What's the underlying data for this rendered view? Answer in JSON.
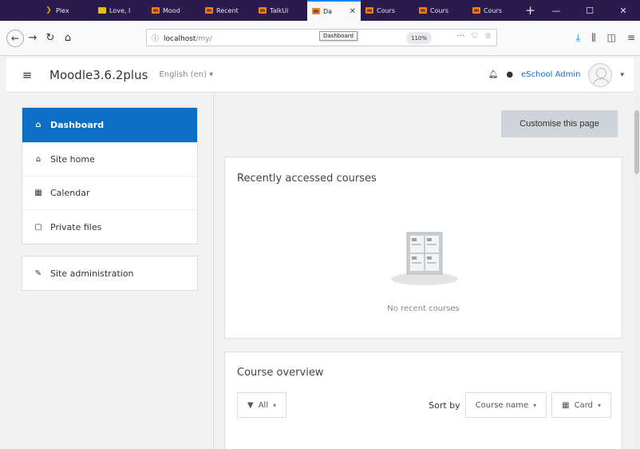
{
  "browser": {
    "tabs": [
      {
        "label": "Plex",
        "fav": "plex"
      },
      {
        "label": "Love, I",
        "fav": "love"
      },
      {
        "label": "Mood",
        "fav": "m"
      },
      {
        "label": "Recent",
        "fav": "m"
      },
      {
        "label": "TalkUi",
        "fav": "m"
      },
      {
        "label": "Da",
        "fav": "m",
        "active": true
      },
      {
        "label": "Cours",
        "fav": "m"
      },
      {
        "label": "Cours",
        "fav": "m"
      },
      {
        "label": "Cours",
        "fav": "m"
      }
    ],
    "tab_fav_text": "m",
    "tab_close": "✕",
    "new_tab": "+",
    "tooltip": "Dashboard",
    "url_host": "localhost",
    "url_path": "/my/",
    "zoom": "110%",
    "url_more": "···",
    "pocket": "♡",
    "star": "☆"
  },
  "header": {
    "site_name": "Moodle3.6.2plus",
    "language": "English (en) ▾",
    "user": "eSchool Admin",
    "caret": "▾"
  },
  "sidebar": {
    "items": [
      {
        "label": "Dashboard",
        "icon": "⌂"
      },
      {
        "label": "Site home",
        "icon": "⌂"
      },
      {
        "label": "Calendar",
        "icon": "▦"
      },
      {
        "label": "Private files",
        "icon": "▢"
      }
    ],
    "admin": {
      "label": "Site administration",
      "icon": "✎"
    }
  },
  "main": {
    "customise_label": "Customise this page",
    "recent": {
      "title": "Recently accessed courses",
      "empty": "No recent courses"
    },
    "overview": {
      "title": "Course overview",
      "filter_label": "All",
      "sort_label": "Sort by",
      "sort_value": "Course name",
      "view_label": "Card"
    }
  },
  "colors": {
    "accent": "#0f6fc5",
    "tabstrip": "#2a1b4d",
    "moodle_orange": "#f98012"
  }
}
